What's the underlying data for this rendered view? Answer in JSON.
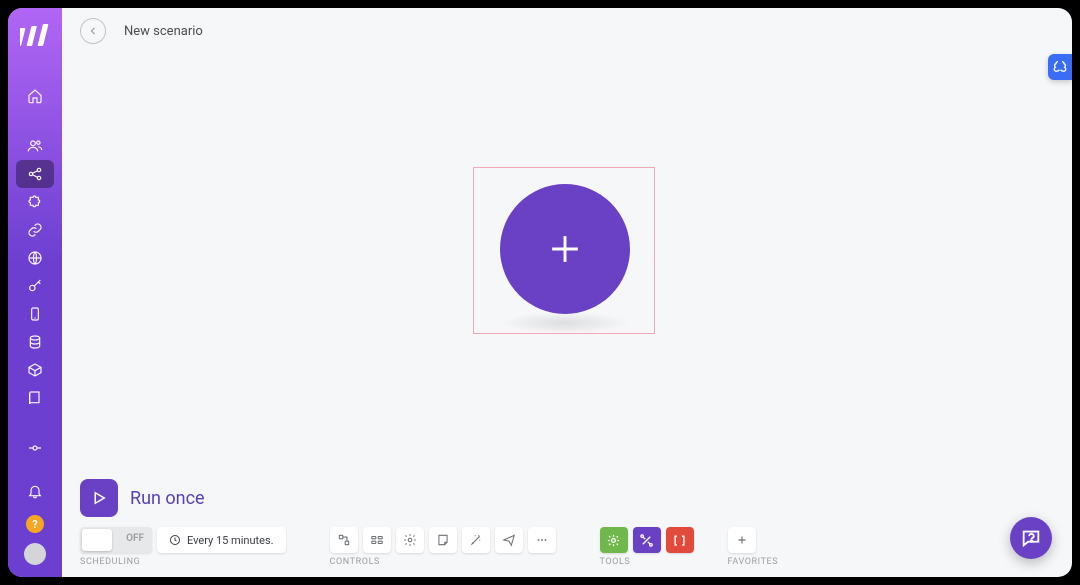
{
  "header": {
    "title": "New scenario"
  },
  "run": {
    "label": "Run once"
  },
  "scheduling": {
    "section_label": "SCHEDULING",
    "toggle_state": "OFF",
    "interval_label": "Every 15 minutes."
  },
  "controls": {
    "section_label": "CONTROLS"
  },
  "tools": {
    "section_label": "TOOLS"
  },
  "favorites": {
    "section_label": "FAVORITES"
  },
  "help": {
    "badge": "?"
  },
  "sidebar": {
    "items": [
      {
        "name": "home"
      },
      {
        "name": "users"
      },
      {
        "name": "scenarios",
        "selected": true
      },
      {
        "name": "apps"
      },
      {
        "name": "connections"
      },
      {
        "name": "globe"
      },
      {
        "name": "keys"
      },
      {
        "name": "phone"
      },
      {
        "name": "datastore"
      },
      {
        "name": "package"
      },
      {
        "name": "book"
      }
    ]
  }
}
